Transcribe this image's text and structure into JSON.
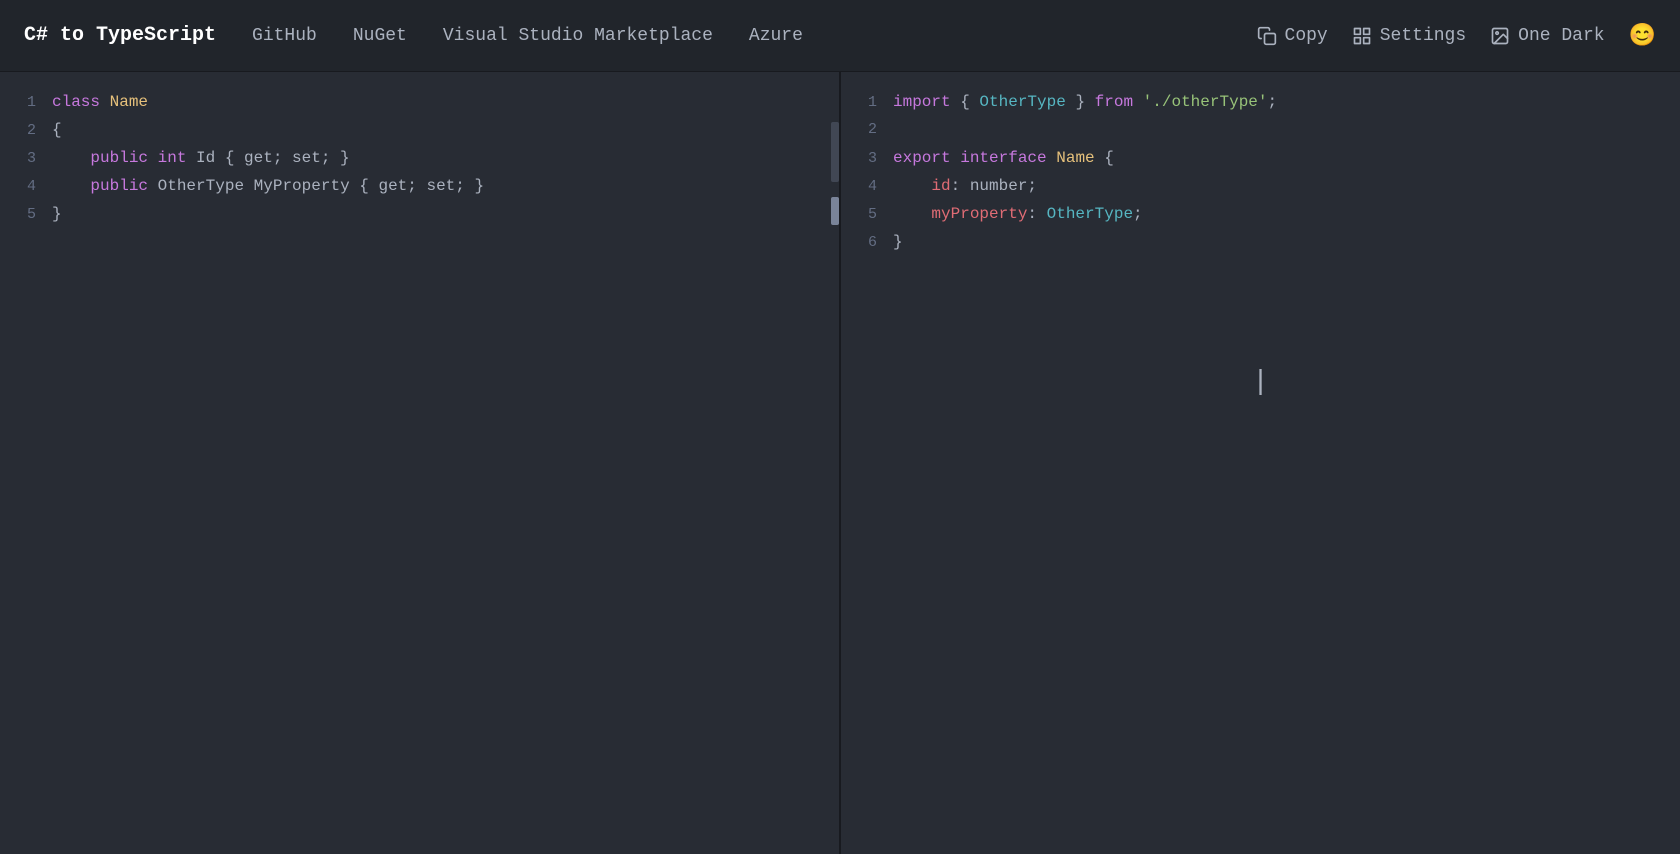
{
  "navbar": {
    "title": "C# to TypeScript",
    "links": [
      {
        "label": "GitHub",
        "id": "github"
      },
      {
        "label": "NuGet",
        "id": "nuget"
      },
      {
        "label": "Visual Studio Marketplace",
        "id": "marketplace"
      },
      {
        "label": "Azure",
        "id": "azure"
      }
    ],
    "actions": [
      {
        "label": "Copy",
        "id": "copy",
        "icon": "copy-icon"
      },
      {
        "label": "Settings",
        "id": "settings",
        "icon": "grid-icon"
      },
      {
        "label": "One Dark",
        "id": "theme",
        "icon": "image-icon"
      },
      {
        "label": "😊",
        "id": "emoji",
        "icon": "emoji-icon"
      }
    ]
  },
  "left_panel": {
    "lines": [
      {
        "number": "1",
        "tokens": [
          {
            "text": "class ",
            "class": "kw-class"
          },
          {
            "text": "Name",
            "class": "type-name"
          }
        ]
      },
      {
        "number": "2",
        "tokens": [
          {
            "text": "{",
            "class": "plain"
          }
        ]
      },
      {
        "number": "3",
        "tokens": [
          {
            "text": "    ",
            "class": "plain"
          },
          {
            "text": "public ",
            "class": "kw-public"
          },
          {
            "text": "int ",
            "class": "kw-int"
          },
          {
            "text": "Id { get; set; }",
            "class": "plain"
          }
        ]
      },
      {
        "number": "4",
        "tokens": [
          {
            "text": "    ",
            "class": "plain"
          },
          {
            "text": "public ",
            "class": "kw-public"
          },
          {
            "text": "OtherType",
            "class": "plain"
          },
          {
            "text": " MyProperty { get; set; }",
            "class": "plain"
          }
        ]
      },
      {
        "number": "5",
        "tokens": [
          {
            "text": "}",
            "class": "plain"
          }
        ]
      }
    ]
  },
  "right_panel": {
    "lines": [
      {
        "number": "1",
        "tokens": [
          {
            "text": "import",
            "class": "kw-import"
          },
          {
            "text": " { ",
            "class": "plain"
          },
          {
            "text": "OtherType",
            "class": "type-name-green"
          },
          {
            "text": " } ",
            "class": "plain"
          },
          {
            "text": "from",
            "class": "kw-from"
          },
          {
            "text": " ",
            "class": "plain"
          },
          {
            "text": "'./otherType'",
            "class": "string"
          },
          {
            "text": ";",
            "class": "plain"
          }
        ]
      },
      {
        "number": "2",
        "tokens": []
      },
      {
        "number": "3",
        "tokens": [
          {
            "text": "export",
            "class": "kw-export"
          },
          {
            "text": " ",
            "class": "plain"
          },
          {
            "text": "interface",
            "class": "kw-interface"
          },
          {
            "text": " ",
            "class": "plain"
          },
          {
            "text": "Name",
            "class": "type-name"
          },
          {
            "text": " {",
            "class": "plain"
          }
        ]
      },
      {
        "number": "4",
        "tokens": [
          {
            "text": "    ",
            "class": "plain"
          },
          {
            "text": "id",
            "class": "prop-name"
          },
          {
            "text": ": number;",
            "class": "plain"
          }
        ]
      },
      {
        "number": "5",
        "tokens": [
          {
            "text": "    ",
            "class": "plain"
          },
          {
            "text": "myProperty",
            "class": "prop-name"
          },
          {
            "text": ": ",
            "class": "plain"
          },
          {
            "text": "OtherType",
            "class": "type-name-green"
          },
          {
            "text": ";",
            "class": "plain"
          }
        ]
      },
      {
        "number": "6",
        "tokens": [
          {
            "text": "}",
            "class": "plain"
          }
        ]
      }
    ]
  },
  "colors": {
    "background": "#282c34",
    "navbar_bg": "#21252b",
    "divider": "#181a1f"
  }
}
